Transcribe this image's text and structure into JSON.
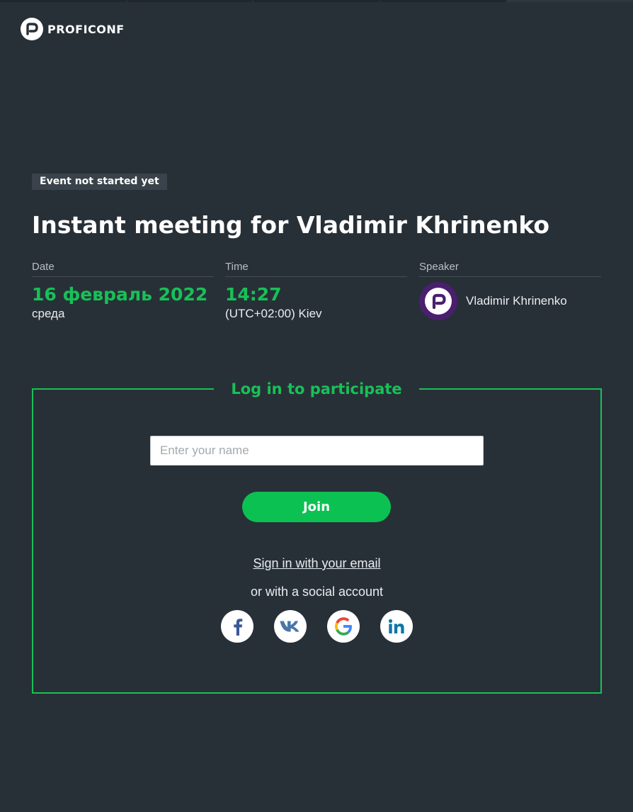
{
  "header": {
    "logo_text": "PROFICONF"
  },
  "event": {
    "status_badge": "Event not started yet",
    "title": "Instant meeting for Vladimir Khrinenko",
    "date": {
      "label": "Date",
      "value": "16 февраль 2022",
      "weekday": "среда"
    },
    "time": {
      "label": "Time",
      "value": "14:27",
      "timezone": "(UTC+02:00) Kiev"
    },
    "speaker": {
      "label": "Speaker",
      "name": "Vladimir Khrinenko"
    }
  },
  "login": {
    "title": "Log in to participate",
    "name_placeholder": "Enter your name",
    "name_value": "",
    "join_label": "Join",
    "email_link": "Sign in with your email",
    "social_text": "or with a social account",
    "social_icons": [
      "facebook-icon",
      "vk-icon",
      "google-icon",
      "linkedin-icon"
    ]
  },
  "colors": {
    "background": "#283037",
    "accent_green": "#17c157",
    "badge_bg": "#3a434b",
    "avatar_purple": "#4a1f6e"
  }
}
